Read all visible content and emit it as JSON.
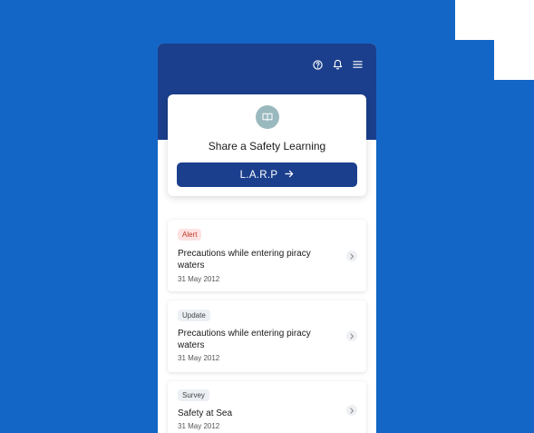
{
  "colors": {
    "background": "#1366c6",
    "header": "#1b3f8c",
    "button": "#1b3f8c",
    "alert_tag_bg": "#fde2e2",
    "alert_tag_text": "#c0392b",
    "badge": "#9ab9bf"
  },
  "header": {
    "icons": [
      "help-icon",
      "bell-icon",
      "menu-icon"
    ]
  },
  "share_card": {
    "icon": "book-icon",
    "title": "Share a Safety Learning",
    "button_label": "L.A.R.P",
    "button_icon": "arrow-right-icon"
  },
  "feed": [
    {
      "tag": "Alert",
      "title": "Precautions while entering piracy waters",
      "date": "31 May 2012"
    },
    {
      "tag": "Update",
      "title": "Precautions while entering piracy waters",
      "date": "31 May 2012"
    },
    {
      "tag": "Survey",
      "title": "Safety at Sea",
      "date": "31 May 2012"
    }
  ]
}
